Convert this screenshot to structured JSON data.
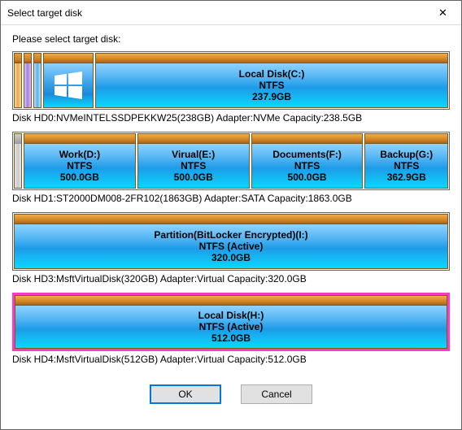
{
  "window": {
    "title": "Select target disk",
    "close_glyph": "✕"
  },
  "prompt": "Please select target disk:",
  "disks": [
    {
      "info": "Disk HD0:NVMeINTELSSDPEKKW25(238GB)  Adapter:NVMe  Capacity:238.5GB",
      "strips": [
        "orange",
        "purple",
        "blue"
      ],
      "has_winlogo": true,
      "selected": false,
      "partitions": [
        {
          "name": "Local Disk(C:)",
          "fs": "NTFS",
          "size": "237.9GB",
          "flex": 1
        }
      ]
    },
    {
      "info": "Disk HD1:ST2000DM008-2FR102(1863GB)  Adapter:SATA  Capacity:1863.0GB",
      "strips": [
        "gray"
      ],
      "has_winlogo": false,
      "selected": false,
      "partitions": [
        {
          "name": "Work(D:)",
          "fs": "NTFS",
          "size": "500.0GB",
          "flex": 1
        },
        {
          "name": "Virual(E:)",
          "fs": "NTFS",
          "size": "500.0GB",
          "flex": 1
        },
        {
          "name": "Documents(F:)",
          "fs": "NTFS",
          "size": "500.0GB",
          "flex": 1
        },
        {
          "name": "Backup(G:)",
          "fs": "NTFS",
          "size": "362.9GB",
          "flex": 0.74
        }
      ]
    },
    {
      "info": "Disk HD3:MsftVirtualDisk(320GB)  Adapter:Virtual  Capacity:320.0GB",
      "strips": [],
      "has_winlogo": false,
      "selected": false,
      "partitions": [
        {
          "name": "Partition(BitLocker Encrypted)(I:)",
          "fs": "NTFS (Active)",
          "size": "320.0GB",
          "flex": 1
        }
      ]
    },
    {
      "info": "Disk HD4:MsftVirtualDisk(512GB)  Adapter:Virtual  Capacity:512.0GB",
      "strips": [],
      "has_winlogo": false,
      "selected": true,
      "partitions": [
        {
          "name": "Local Disk(H:)",
          "fs": "NTFS (Active)",
          "size": "512.0GB",
          "flex": 1
        }
      ]
    }
  ],
  "buttons": {
    "ok": "OK",
    "cancel": "Cancel"
  }
}
